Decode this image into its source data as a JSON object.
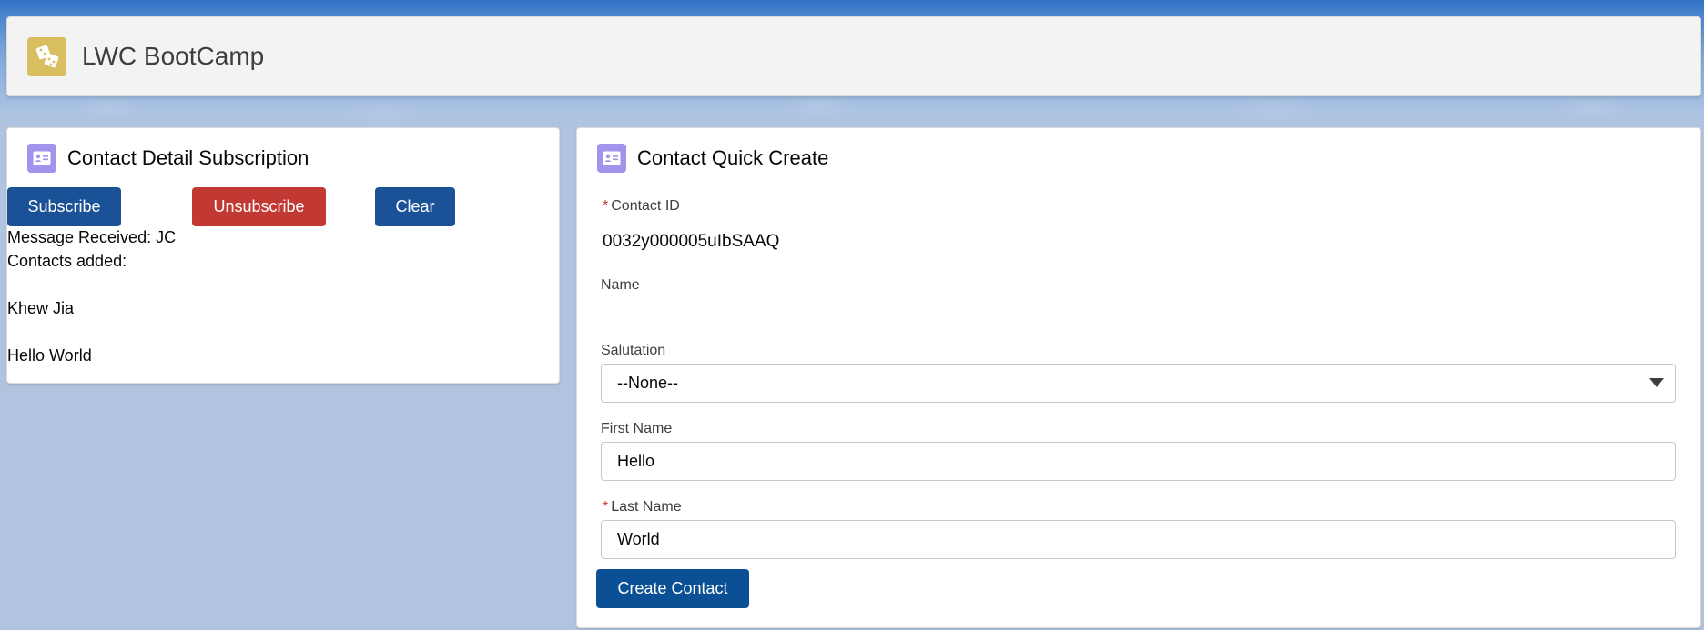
{
  "app": {
    "title": "LWC BootCamp",
    "icon": "dice-icon"
  },
  "subscription_card": {
    "title": "Contact Detail Subscription",
    "icon": "contact-card-icon",
    "buttons": {
      "subscribe": "Subscribe",
      "unsubscribe": "Unsubscribe",
      "clear": "Clear"
    },
    "message_received": "Message Received: JC",
    "contacts_added_label": "Contacts added:",
    "contacts": [
      "Khew Jia",
      "Hello World"
    ]
  },
  "quick_create_card": {
    "title": "Contact Quick Create",
    "icon": "contact-card-icon",
    "fields": {
      "contact_id": {
        "label": "Contact ID",
        "required": "*",
        "value": "0032y000005uIbSAAQ"
      },
      "name": {
        "label": "Name"
      },
      "salutation": {
        "label": "Salutation",
        "value": "--None--"
      },
      "first_name": {
        "label": "First Name",
        "value": "Hello"
      },
      "last_name": {
        "label": "Last Name",
        "required": "*",
        "value": "World"
      }
    },
    "create_button": "Create Contact"
  },
  "colors": {
    "brand": "#1b5297",
    "destructive": "#c23934",
    "app_icon": "#d8be5f",
    "contact_icon": "#a094ed"
  }
}
